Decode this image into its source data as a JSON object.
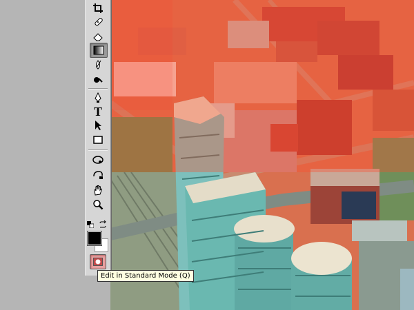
{
  "toolbar": {
    "tools": [
      {
        "name": "crop-tool",
        "icon": "crop-icon"
      },
      {
        "name": "healing-brush-tool",
        "icon": "bandage-icon"
      },
      {
        "name": "eraser-tool",
        "icon": "eraser-icon"
      },
      {
        "name": "gradient-tool",
        "icon": "gradient-icon",
        "selected": true
      },
      {
        "name": "blur-tool",
        "icon": "drop-icon"
      },
      {
        "name": "burn-tool",
        "icon": "burn-icon"
      },
      {
        "name": "pen-tool",
        "icon": "pen-icon"
      },
      {
        "name": "type-tool",
        "icon": "type-icon",
        "glyph": "T"
      },
      {
        "name": "path-selection-tool",
        "icon": "arrow-icon"
      },
      {
        "name": "rectangle-tool",
        "icon": "rectangle-icon"
      },
      {
        "name": "3d-rotate-tool",
        "icon": "3d-rotate-icon"
      },
      {
        "name": "3d-orbit-tool",
        "icon": "3d-orbit-icon"
      },
      {
        "name": "hand-tool",
        "icon": "hand-icon"
      },
      {
        "name": "zoom-tool",
        "icon": "zoom-icon"
      }
    ],
    "foreground_color": "#000000",
    "background_color": "#ffffff",
    "quick_mask_color": "#e8a0a0"
  },
  "tooltip": {
    "text": "Edit in Standard Mode (Q)"
  },
  "photo": {
    "description_tint": "#e85a3c"
  }
}
